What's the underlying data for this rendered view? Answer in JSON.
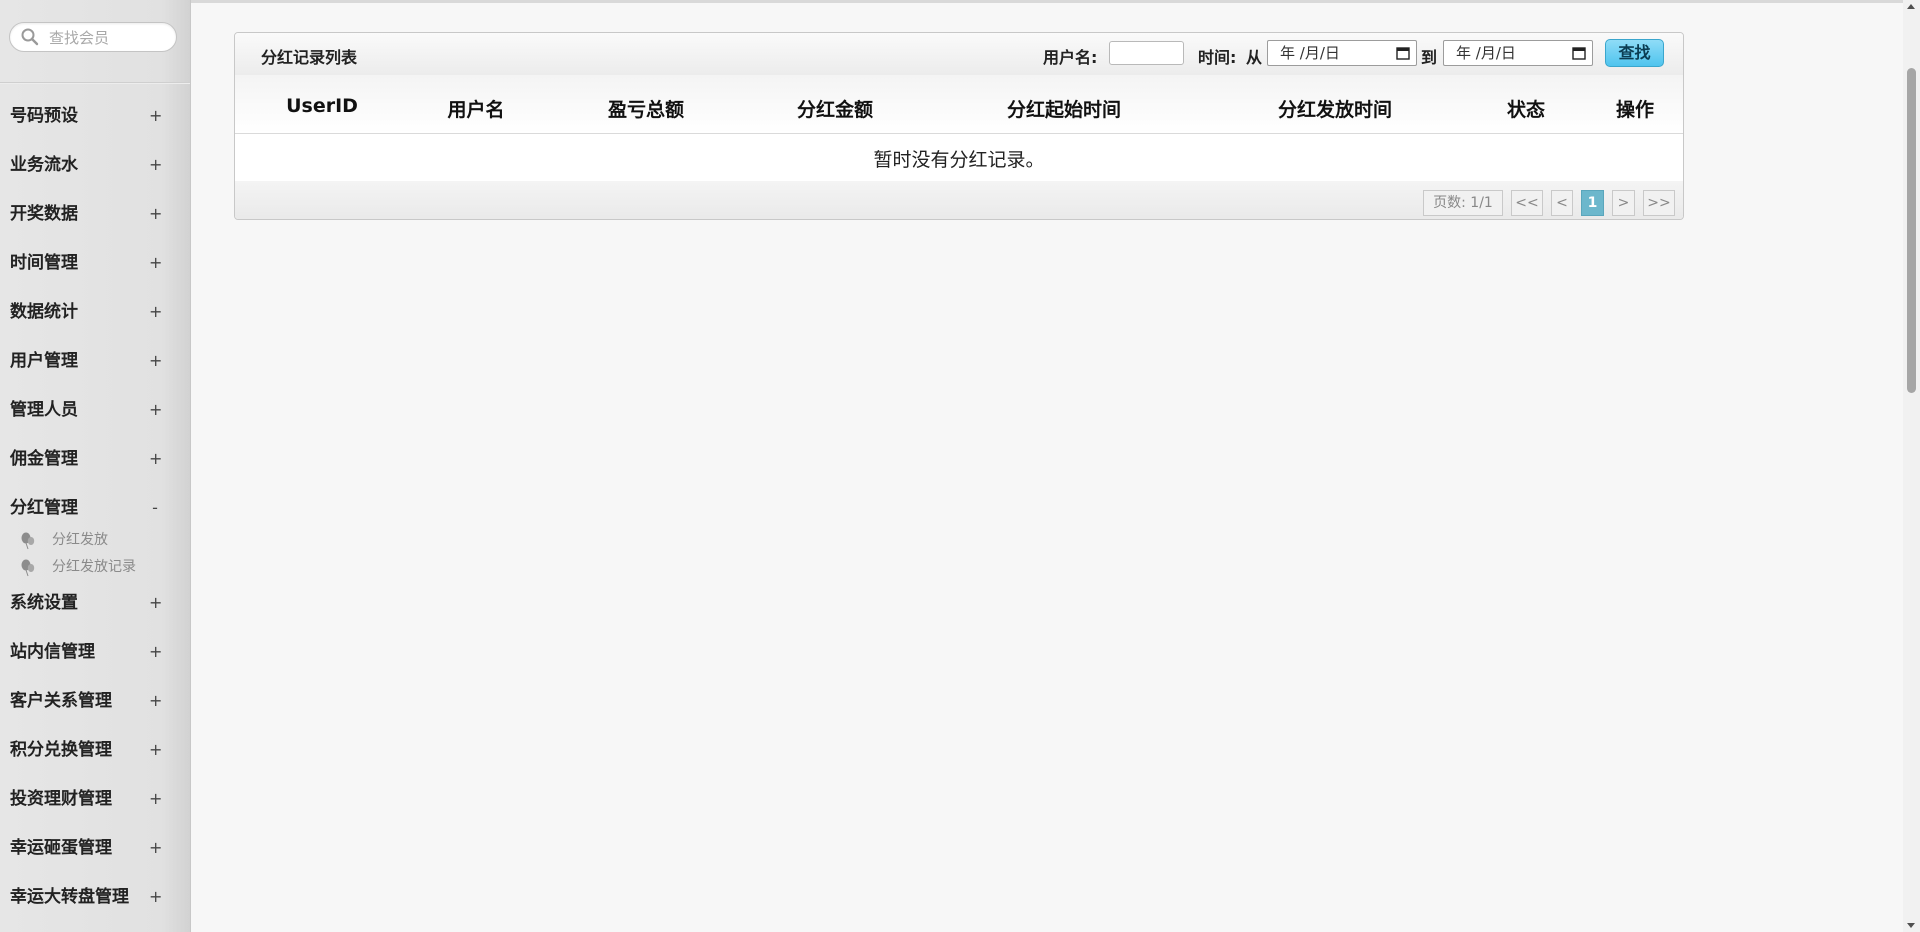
{
  "sidebar": {
    "search_placeholder": "查找会员",
    "menu": [
      {
        "label": "号码预设",
        "toggle": "+"
      },
      {
        "label": "业务流水",
        "toggle": "+"
      },
      {
        "label": "开奖数据",
        "toggle": "+"
      },
      {
        "label": "时间管理",
        "toggle": "+"
      },
      {
        "label": "数据统计",
        "toggle": "+"
      },
      {
        "label": "用户管理",
        "toggle": "+"
      },
      {
        "label": "管理人员",
        "toggle": "+"
      },
      {
        "label": "佣金管理",
        "toggle": "+"
      },
      {
        "label": "分红管理",
        "toggle": "-"
      },
      {
        "label": "系统设置",
        "toggle": "+"
      },
      {
        "label": "站内信管理",
        "toggle": "+"
      },
      {
        "label": "客户关系管理",
        "toggle": "+"
      },
      {
        "label": "积分兑换管理",
        "toggle": "+"
      },
      {
        "label": "投资理财管理",
        "toggle": "+"
      },
      {
        "label": "幸运砸蛋管理",
        "toggle": "+"
      },
      {
        "label": "幸运大转盘管理",
        "toggle": "+"
      }
    ],
    "submenu": [
      {
        "label": "分红发放"
      },
      {
        "label": "分红发放记录"
      }
    ]
  },
  "panel": {
    "title": "分红记录列表",
    "username_label": "用户名:",
    "time_label": "时间:",
    "from_label": "从",
    "to_label": "到",
    "date_from": "年 /月/日",
    "date_to": "年 /月/日",
    "search_button": "查找"
  },
  "table": {
    "columns": [
      "UserID",
      "用户名",
      "盈亏总额",
      "分红金额",
      "分红起始时间",
      "分红发放时间",
      "状态",
      "操作"
    ],
    "empty_message": "暂时没有分红记录。"
  },
  "pager": {
    "page_info": "页数: 1/1",
    "first": "<<",
    "prev": "<",
    "current": "1",
    "next": ">",
    "last": ">>"
  }
}
